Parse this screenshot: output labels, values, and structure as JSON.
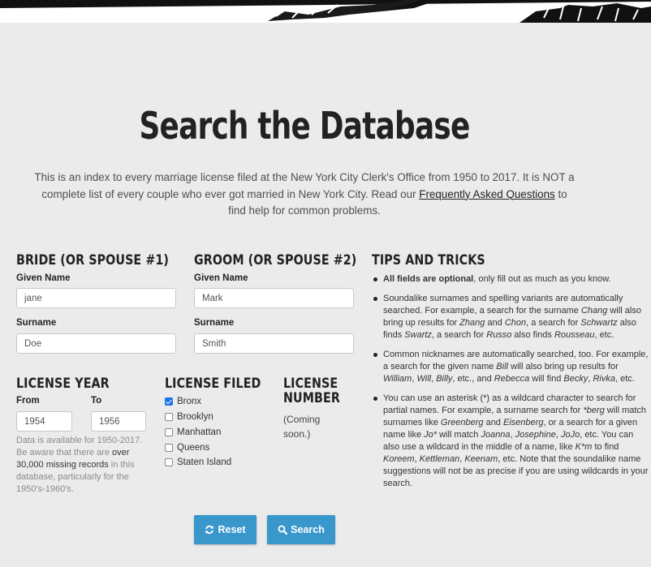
{
  "page": {
    "title": "Search the Database",
    "intro": {
      "text1": "This is an index to every marriage license filed at the New York City Clerk's Office from 1950 to 2017. It is NOT a complete list of every couple who ever got married in New York City. Read our ",
      "link": "Frequently Asked Questions",
      "text2": " to find help for common problems."
    }
  },
  "bride": {
    "heading": "BRIDE (OR SPOUSE #1)",
    "given_label": "Given Name",
    "given_value": "jane",
    "surname_label": "Surname",
    "surname_value": "Doe"
  },
  "groom": {
    "heading": "GROOM (OR SPOUSE #2)",
    "given_label": "Given Name",
    "given_value": "Mark",
    "surname_label": "Surname",
    "surname_value": "Smith"
  },
  "license_year": {
    "heading": "LICENSE YEAR",
    "from_label": "From",
    "from_value": "1954",
    "to_label": "To",
    "to_value": "1956",
    "note1": "Data is available for 1950-2017. Be aware that there are ",
    "note_strong": "over 30,000 missing records",
    "note2": " in this database, particularly for the 1950's-1960's."
  },
  "license_filed": {
    "heading": "LICENSE FILED",
    "options": [
      {
        "label": "Bronx",
        "checked": true
      },
      {
        "label": "Brooklyn",
        "checked": false
      },
      {
        "label": "Manhattan",
        "checked": false
      },
      {
        "label": "Queens",
        "checked": false
      },
      {
        "label": "Staten Island",
        "checked": false
      }
    ]
  },
  "license_number": {
    "heading_line1": "LICENSE",
    "heading_line2": "NUMBER",
    "coming": "(Coming soon.)"
  },
  "buttons": {
    "reset": "Reset",
    "search": "Search"
  },
  "tips": {
    "heading": "TIPS AND TRICKS",
    "items": [
      {
        "b": "All fields are optional",
        "t1": ", only fill out as much as you know."
      },
      {
        "t1": "Soundalike surnames and spelling variants are automatically searched. For example, a search for the surname ",
        "e1": "Chang",
        "t2": " will also bring up results for ",
        "e2": "Zhang",
        "t3": " and ",
        "e3": "Chon",
        "t4": ", a search for ",
        "e4": "Schwartz",
        "t5": " also finds ",
        "e5": "Swartz",
        "t6": ", a search for ",
        "e6": "Russo",
        "t7": " also finds ",
        "e7": "Rousseau",
        "t8": ", etc."
      },
      {
        "t1": "Common nicknames are automatically searched, too. For example, a search for the given name ",
        "e1": "Bill",
        "t2": " will also bring up results for ",
        "e2": "William",
        "t3": ", ",
        "e3": "Will",
        "t4": ", ",
        "e4": "Billy",
        "t5": ", etc., and ",
        "e5": "Rebecca",
        "t6": " will find ",
        "e6": "Becky",
        "t7": ", ",
        "e7": "Rivka",
        "t8": ", etc."
      },
      {
        "t1": "You can use an asterisk (*) as a wildcard character to search for partial names. For example, a surname search for ",
        "e1": "*berg",
        "t2": " will match surnames like ",
        "e2": "Greenberg",
        "t3": " and ",
        "e3": "Eisenberg",
        "t4": ", or a search for a given name like ",
        "e4": "Jo*",
        "t5": " will match ",
        "e5": "Joanna",
        "t6": ", ",
        "e6": "Josephine",
        "t7": ", ",
        "e7": "JoJo",
        "t8": ", etc. You can also use a wildcard in the middle of a name, like ",
        "e8": "K*m",
        "t9": " to find ",
        "e9": "Koreem",
        "t10": ", ",
        "e10": "Kettleman",
        "t11": ", ",
        "e11": "Keenam",
        "t12": ", etc. Note that the soundalike name suggestions will not be as precise if you are using wildcards in your search."
      }
    ]
  }
}
